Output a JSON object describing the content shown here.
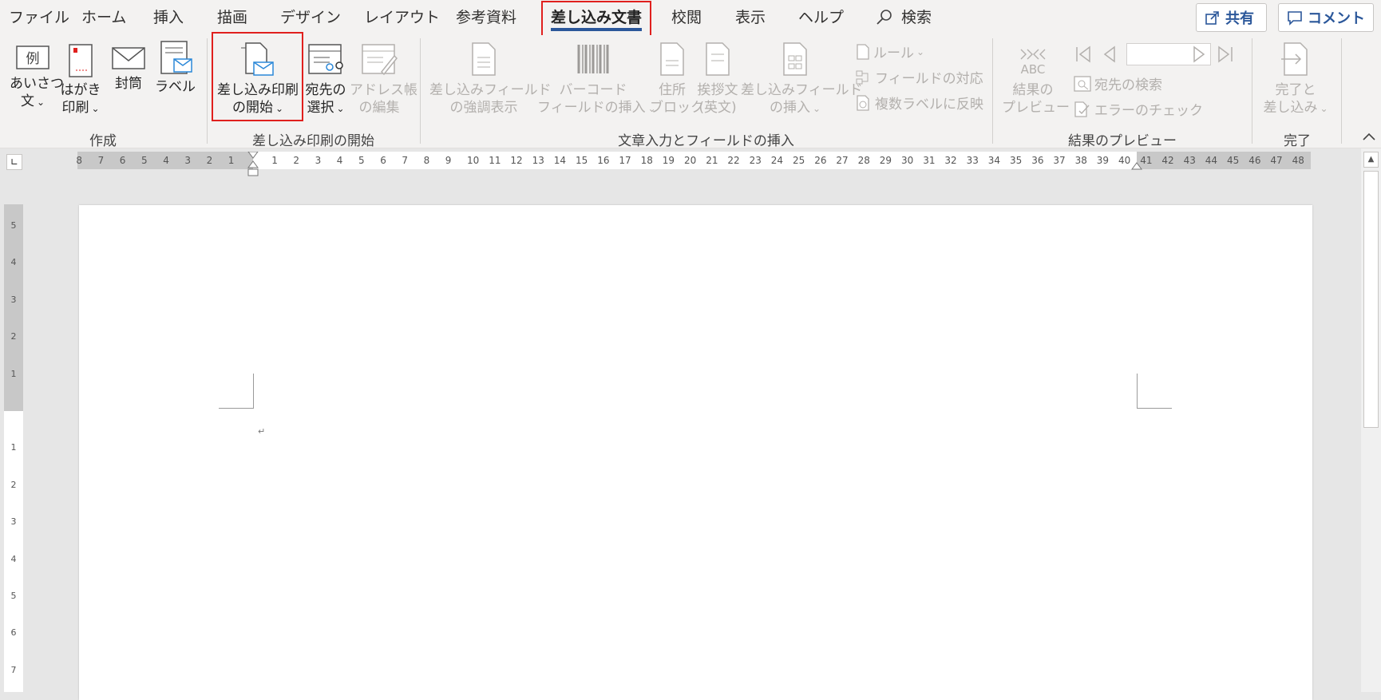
{
  "tabs": [
    {
      "label": "ファイル"
    },
    {
      "label": "ホーム"
    },
    {
      "label": "挿入"
    },
    {
      "label": "描画"
    },
    {
      "label": "デザイン"
    },
    {
      "label": "レイアウト"
    },
    {
      "label": "参考資料"
    },
    {
      "label": "差し込み文書"
    },
    {
      "label": "校閲"
    },
    {
      "label": "表示"
    },
    {
      "label": "ヘルプ"
    }
  ],
  "search_label": "検索",
  "share_label": "共有",
  "comment_label": "コメント",
  "ribbon": {
    "create": {
      "group": "作成",
      "greeting_l1": "あいさつ",
      "greeting_l2": "文",
      "postcard_l1": "はがき",
      "postcard_l2": "印刷",
      "envelope": "封筒",
      "label": "ラベル",
      "sample_glyph": "例"
    },
    "start": {
      "group": "差し込み印刷の開始",
      "start_l1": "差し込み印刷",
      "start_l2": "の開始",
      "recip_l1": "宛先の",
      "recip_l2": "選択",
      "addr_l1": "アドレス帳",
      "addr_l2": "の編集"
    },
    "write": {
      "group": "文章入力とフィールドの挿入",
      "highlight_l1": "差し込みフィールド",
      "highlight_l2": "の強調表示",
      "barcode_l1": "バーコード",
      "barcode_l2": "フィールドの挿入",
      "address_l1": "住所",
      "address_l2": "ブロック",
      "greetingline_l1": "挨拶文",
      "greetingline_l2": "(英文)",
      "insertfield_l1": "差し込みフィールド",
      "insertfield_l2": "の挿入",
      "rules": "ルール",
      "match": "フィールドの対応",
      "update": "複数ラベルに反映"
    },
    "preview": {
      "group": "結果のプレビュー",
      "preview_l1": "結果の",
      "preview_l2": "プレビュー",
      "preview_glyph": "ABC",
      "find": "宛先の検索",
      "check": "エラーのチェック"
    },
    "finish": {
      "group": "完了",
      "finish_l1": "完了と",
      "finish_l2": "差し込み"
    }
  },
  "ruler": {
    "left_nums": [
      "8",
      "7",
      "6",
      "5",
      "4",
      "3",
      "2",
      "1"
    ],
    "right_nums": [
      "1",
      "2",
      "3",
      "4",
      "5",
      "6",
      "7",
      "8",
      "9",
      "10",
      "11",
      "12",
      "13",
      "14",
      "15",
      "16",
      "17",
      "18",
      "19",
      "20",
      "21",
      "22",
      "23",
      "24",
      "25",
      "26",
      "27",
      "28",
      "29",
      "30",
      "31",
      "32",
      "33",
      "34",
      "35",
      "36",
      "37",
      "38",
      "39",
      "40",
      "41",
      "42",
      "43",
      "44",
      "45",
      "46",
      "47",
      "48"
    ],
    "v_top_nums": [
      "5",
      "4",
      "3",
      "2",
      "1"
    ],
    "v_bottom_nums": [
      "1",
      "2",
      "3",
      "4",
      "5",
      "6",
      "7"
    ]
  },
  "document": {
    "paragraph_mark": "↵"
  },
  "colors": {
    "accent": "#2b579a",
    "highlight": "#e0201e",
    "ribbon_bg": "#f3f2f1"
  }
}
